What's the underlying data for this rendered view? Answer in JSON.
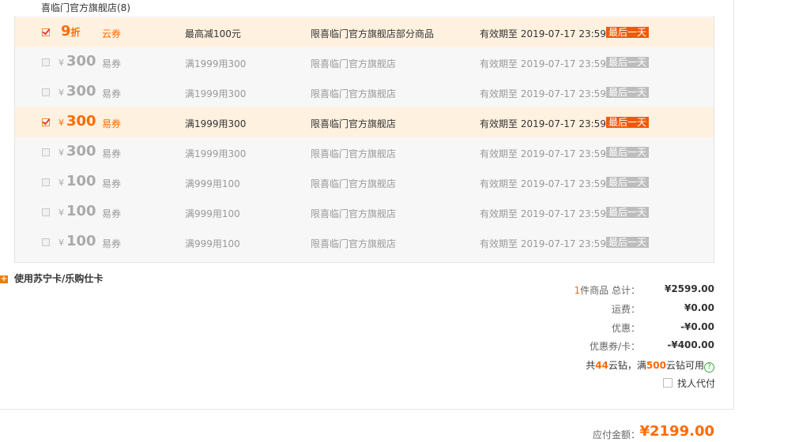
{
  "store_title": "喜临门官方旗舰店(8)",
  "coupons": [
    {
      "selected": true,
      "yen": "",
      "value": "9",
      "unit": "折",
      "type": "云券",
      "condition": "最高减100元",
      "scope": "限喜临门官方旗舰店部分商品",
      "expiry": "有效期至 2019-07-17 23:59",
      "badge": "最后一天"
    },
    {
      "selected": false,
      "yen": "¥",
      "value": "300",
      "unit": "",
      "type": "易券",
      "condition": "满1999用300",
      "scope": "限喜临门官方旗舰店",
      "expiry": "有效期至 2019-07-17 23:59",
      "badge": "最后一天"
    },
    {
      "selected": false,
      "yen": "¥",
      "value": "300",
      "unit": "",
      "type": "易券",
      "condition": "满1999用300",
      "scope": "限喜临门官方旗舰店",
      "expiry": "有效期至 2019-07-17 23:59",
      "badge": "最后一天"
    },
    {
      "selected": true,
      "yen": "¥",
      "value": "300",
      "unit": "",
      "type": "易券",
      "condition": "满1999用300",
      "scope": "限喜临门官方旗舰店",
      "expiry": "有效期至 2019-07-17 23:59",
      "badge": "最后一天"
    },
    {
      "selected": false,
      "yen": "¥",
      "value": "300",
      "unit": "",
      "type": "易券",
      "condition": "满1999用300",
      "scope": "限喜临门官方旗舰店",
      "expiry": "有效期至 2019-07-17 23:59",
      "badge": "最后一天"
    },
    {
      "selected": false,
      "yen": "¥",
      "value": "100",
      "unit": "",
      "type": "易券",
      "condition": "满999用100",
      "scope": "限喜临门官方旗舰店",
      "expiry": "有效期至 2019-07-17 23:59",
      "badge": "最后一天"
    },
    {
      "selected": false,
      "yen": "¥",
      "value": "100",
      "unit": "",
      "type": "易券",
      "condition": "满999用100",
      "scope": "限喜临门官方旗舰店",
      "expiry": "有效期至 2019-07-17 23:59",
      "badge": "最后一天"
    },
    {
      "selected": false,
      "yen": "¥",
      "value": "100",
      "unit": "",
      "type": "易券",
      "condition": "满999用100",
      "scope": "限喜临门官方旗舰店",
      "expiry": "有效期至 2019-07-17 23:59",
      "badge": "最后一天"
    }
  ],
  "card_toggle": {
    "icon": "plus-icon",
    "label": "使用苏宁卡/乐购仕卡"
  },
  "summary": {
    "item_count": "1",
    "item_suffix": "件商品",
    "total_label": "总计：",
    "total_value": "¥2599.00",
    "shipping_label": "运费：",
    "shipping_value": "¥0.00",
    "discount_label": "优惠：",
    "discount_value": "-¥0.00",
    "coupon_label": "优惠券/卡：",
    "coupon_value": "-¥400.00",
    "diamond_prefix": "共",
    "diamond_count": "44",
    "diamond_mid": "云钻，满",
    "diamond_threshold": "500",
    "diamond_suffix": "云钻可用",
    "help_icon": "?",
    "proxy_label": "找人代付"
  },
  "payable": {
    "label": "应付金额：",
    "value": "¥2199.00"
  },
  "colors": {
    "accent": "#ff6a00",
    "badge_active": "#f25807",
    "selected_row_bg": "#fff1df"
  }
}
